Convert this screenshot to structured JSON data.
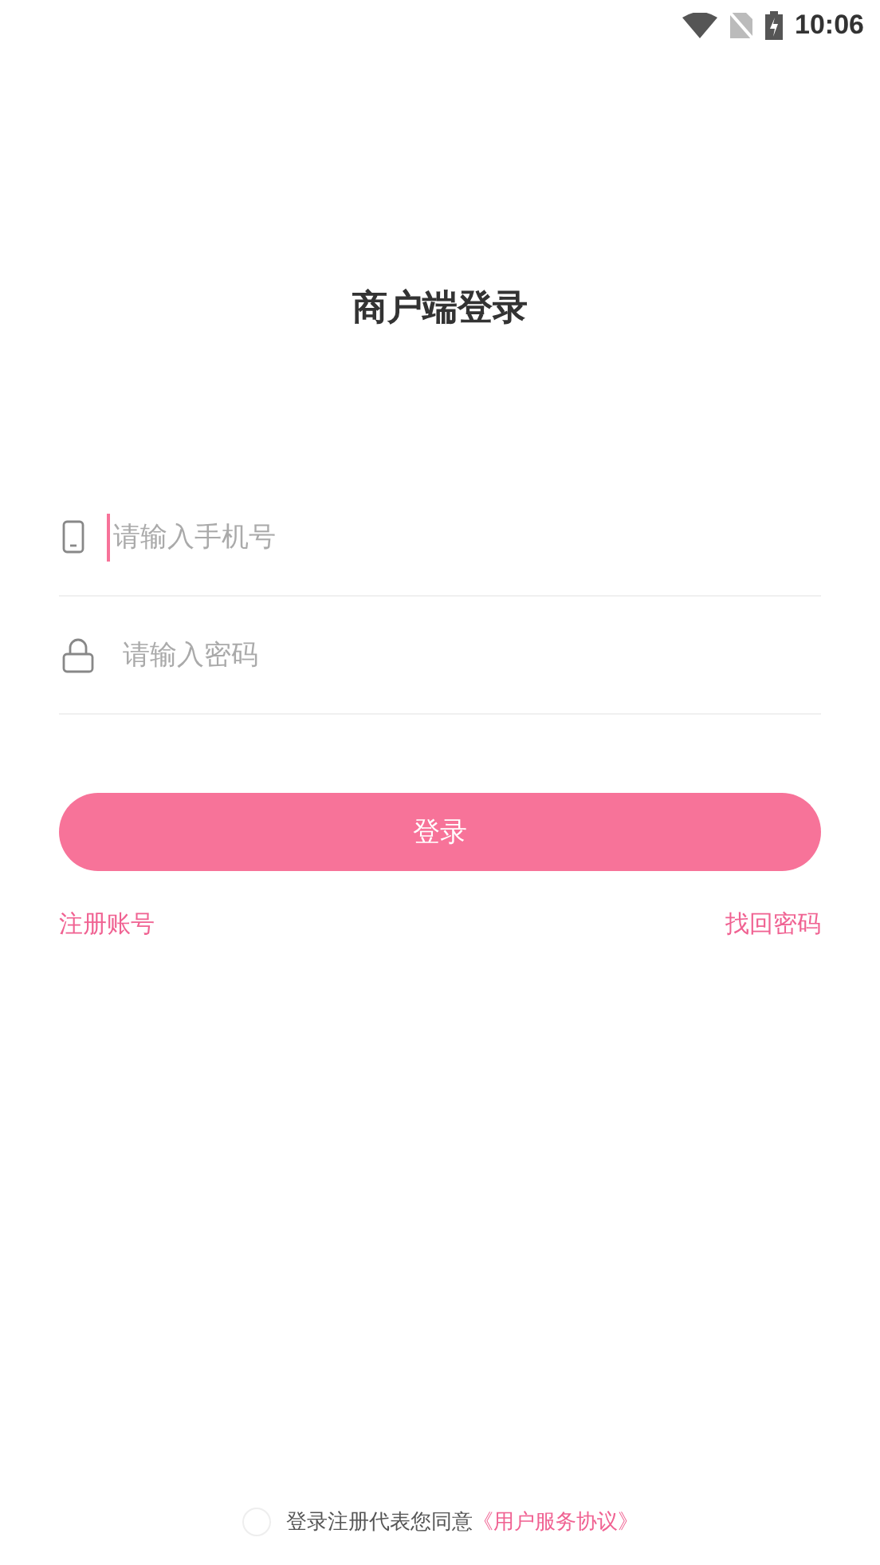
{
  "status_bar": {
    "time": "10:06"
  },
  "title": "商户端登录",
  "fields": [
    {
      "kind": "phone",
      "placeholder": "请输入手机号",
      "focused": true
    },
    {
      "kind": "password",
      "placeholder": "请输入密码",
      "focused": false
    }
  ],
  "login_button": "登录",
  "links": [
    "注册账号",
    "找回密码"
  ],
  "agreement": {
    "checked": false,
    "text": "登录注册代表您同意",
    "link": "《用户服务协议》"
  }
}
